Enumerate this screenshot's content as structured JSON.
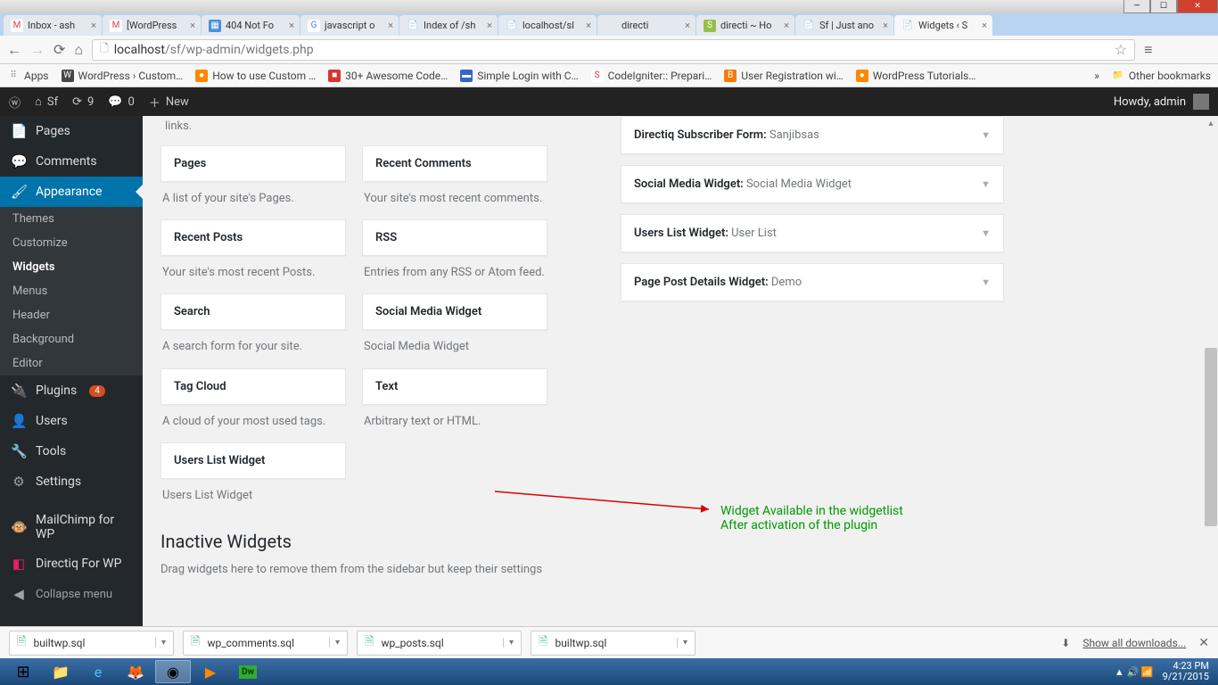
{
  "window_buttons": {
    "min": "—",
    "max": "☐",
    "close": "✕"
  },
  "tabs": [
    {
      "label": "Inbox - ash",
      "fav": "M",
      "favbg": "#fff",
      "favcol": "#d44"
    },
    {
      "label": "[WordPress",
      "fav": "M",
      "favbg": "#fff",
      "favcol": "#d44"
    },
    {
      "label": "404 Not Fo",
      "fav": "▦",
      "favbg": "#4a90d9",
      "favcol": "#fff"
    },
    {
      "label": "javascript o",
      "fav": "G",
      "favbg": "#fff",
      "favcol": "#4285f4"
    },
    {
      "label": "Index of /sh",
      "fav": "📄",
      "favbg": "",
      "favcol": ""
    },
    {
      "label": "localhost/sl",
      "fav": "📄",
      "favbg": "",
      "favcol": ""
    },
    {
      "label": "directi",
      "fav": "",
      "favbg": "",
      "favcol": ""
    },
    {
      "label": "directi ~ Ho",
      "fav": "S",
      "favbg": "#95bf47",
      "favcol": "#fff"
    },
    {
      "label": "Sf | Just ano",
      "fav": "📄",
      "favbg": "",
      "favcol": ""
    },
    {
      "label": "Widgets ‹ S",
      "fav": "📄",
      "favbg": "",
      "favcol": "",
      "active": true
    }
  ],
  "url": {
    "host": "localhost",
    "path": "/sf/wp-admin/widgets.php"
  },
  "bookmarks": [
    {
      "label": "Apps",
      "icon": "⠿",
      "bg": "",
      "col": "#888"
    },
    {
      "label": "WordPress › Custom…",
      "icon": "W",
      "bg": "#464646",
      "col": "#fff"
    },
    {
      "label": "How to use Custom …",
      "icon": "●",
      "bg": "#f80",
      "col": "#fff"
    },
    {
      "label": "30+ Awesome Code…",
      "icon": "■",
      "bg": "#d33",
      "col": "#fff"
    },
    {
      "label": "Simple Login with C…",
      "icon": "▬",
      "bg": "#36c",
      "col": "#fff"
    },
    {
      "label": "CodeIgniter:: Prepari…",
      "icon": "S",
      "bg": "#fff",
      "col": "#d33"
    },
    {
      "label": "User Registration wi…",
      "icon": "B",
      "bg": "#f57c00",
      "col": "#fff"
    },
    {
      "label": "WordPress Tutorials…",
      "icon": "●",
      "bg": "#f80",
      "col": "#fff"
    }
  ],
  "bookmarks_more": "»",
  "bookmarks_other": "Other bookmarks",
  "adminbar": {
    "site": "Sf",
    "updates": "9",
    "comments": "0",
    "new": "New",
    "howdy": "Howdy, admin"
  },
  "menu": {
    "pages": "Pages",
    "comments": "Comments",
    "appearance": "Appearance",
    "appearance_sub": [
      "Themes",
      "Customize",
      "Widgets",
      "Menus",
      "Header",
      "Background",
      "Editor"
    ],
    "plugins": "Plugins",
    "plugins_badge": "4",
    "users": "Users",
    "tools": "Tools",
    "settings": "Settings",
    "mailchimp": "MailChimp for WP",
    "directiq": "Directiq For WP",
    "collapse": "Collapse menu"
  },
  "top_desc_tail": "links.",
  "available_widgets": [
    {
      "title": "Pages",
      "desc": "A list of your site's Pages."
    },
    {
      "title": "Recent Comments",
      "desc": "Your site's most recent comments."
    },
    {
      "title": "Recent Posts",
      "desc": "Your site's most recent Posts."
    },
    {
      "title": "RSS",
      "desc": "Entries from any RSS or Atom feed."
    },
    {
      "title": "Search",
      "desc": "A search form for your site."
    },
    {
      "title": "Social Media Widget",
      "desc": "Social Media Widget"
    },
    {
      "title": "Tag Cloud",
      "desc": "A cloud of your most used tags."
    },
    {
      "title": "Text",
      "desc": "Arbitrary text or HTML."
    },
    {
      "title": "Users List Widget",
      "desc": "Users List Widget"
    }
  ],
  "sidebar_widgets": [
    {
      "title": "Directiq Subscriber Form:",
      "value": " Sanjibsas"
    },
    {
      "title": "Social Media Widget:",
      "value": " Social Media Widget"
    },
    {
      "title": "Users List Widget:",
      "value": " User List"
    },
    {
      "title": "Page Post Details Widget:",
      "value": " Demo"
    }
  ],
  "annotation_l1": "Widget Available in the widgetlist",
  "annotation_l2": "After activation of the plugin",
  "inactive": {
    "heading": "Inactive Widgets",
    "text": "Drag widgets here to remove them from the sidebar but keep their settings"
  },
  "downloads": {
    "items": [
      "builtwp.sql",
      "wp_comments.sql",
      "wp_posts.sql",
      "builtwp.sql"
    ],
    "show_all": "Show all downloads..."
  },
  "tray": {
    "time": "4:23 PM",
    "date": "9/21/2015"
  }
}
